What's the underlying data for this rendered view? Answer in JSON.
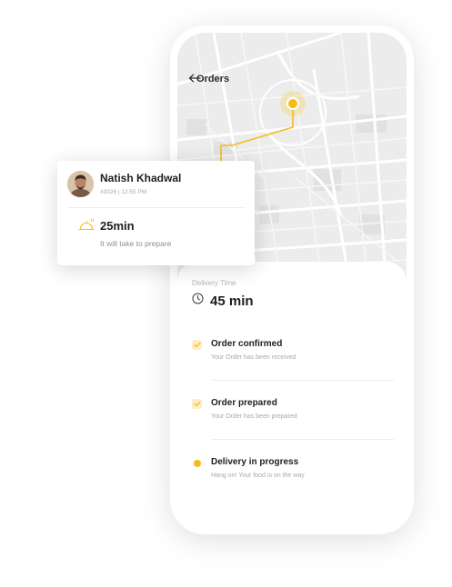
{
  "map": {
    "title": "Orders"
  },
  "delivery": {
    "label": "Delivery Time",
    "value": "45 min"
  },
  "steps": [
    {
      "title": "Order confirmed",
      "subtitle": "Your Order has been received",
      "status": "done"
    },
    {
      "title": "Order prepared",
      "subtitle": "Your Order has been prepared",
      "status": "done"
    },
    {
      "title": "Delivery in progress",
      "subtitle": "Hang on! Your food is on the way",
      "status": "in-progress"
    }
  ],
  "card": {
    "name": "Natish Khadwal",
    "meta": "#3326  |  12:55 PM",
    "prep_time": "25min",
    "prep_text": "It will take to prepare"
  },
  "colors": {
    "accent": "#f6ba1a",
    "accent_light": "#fdeec3",
    "map_bg": "#ececec"
  },
  "icons": {
    "back": "back-arrow-icon",
    "clock": "clock-icon",
    "check": "check-icon",
    "pin": "location-pin-icon",
    "prep": "cooking-icon"
  }
}
